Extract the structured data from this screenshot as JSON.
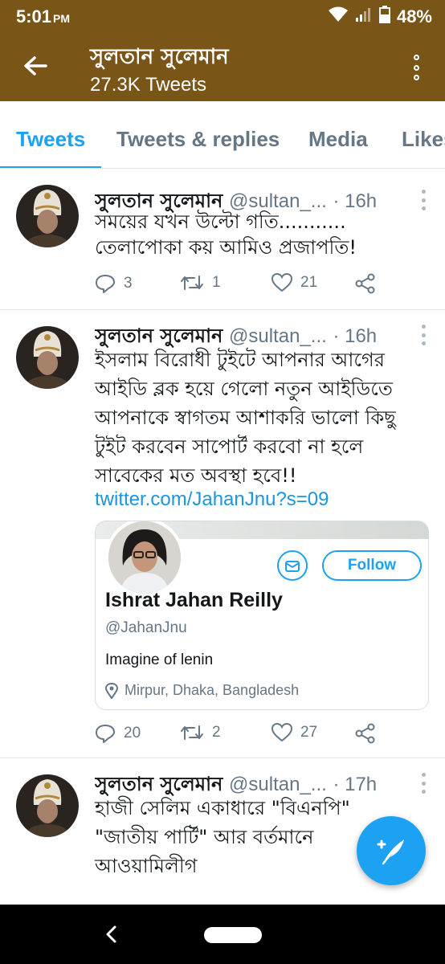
{
  "status_bar": {
    "time": "5:01",
    "ampm": "PM",
    "battery": "48%"
  },
  "header": {
    "title": "সুলতান সুলেমান",
    "subtitle": "27.3K Tweets"
  },
  "tabs": [
    {
      "label": "Tweets",
      "active": true
    },
    {
      "label": "Tweets & replies",
      "active": false
    },
    {
      "label": "Media",
      "active": false
    },
    {
      "label": "Likes",
      "active": false
    }
  ],
  "tweets": [
    {
      "name": "সুলতান সুলেমান",
      "handle": "@sultan_...",
      "time": "· 16h",
      "lines": [
        "সময়ের যখন উল্টো গতি...........",
        "তেলাপোকা কয় আমিও প্রজাপতি!"
      ],
      "replies": "3",
      "retweets": "1",
      "likes": "21"
    },
    {
      "name": "সুলতান সুলেমান",
      "handle": "@sultan_...",
      "time": "· 16h",
      "lines": [
        "ইসলাম বিরোধী টুইটে আপনার আগের",
        "আইডি ব্লক হয়ে গেলো নতুন আইডিতে",
        "আপনাকে স্বাগতম আশাকরি ভালো কিছু",
        "টুইট করবেন সাপোর্ট করবো না হলে",
        "সাবেকের মত অবস্থা হবে!!"
      ],
      "link": "twitter.com/JahanJnu?s=09",
      "card": {
        "follow_label": "Follow",
        "name": "Ishrat Jahan Reilly",
        "handle": "@JahanJnu",
        "bio": "Imagine of lenin",
        "location": "Mirpur, Dhaka, Bangladesh"
      },
      "replies": "20",
      "retweets": "2",
      "likes": "27"
    },
    {
      "name": "সুলতান সুলেমান",
      "handle": "@sultan_...",
      "time": "· 17h",
      "lines": [
        "হাজী সেলিম একাধারে \"বিএনপি\"",
        "\"জাতীয় পার্টি\" আর বর্তমানে",
        "আওয়ামিলীগ"
      ]
    }
  ],
  "colors": {
    "header_bg": "#7a5518",
    "accent": "#1da1f2",
    "muted": "#657786"
  },
  "icons": [
    "back-arrow-icon",
    "overflow-menu-icon",
    "reply-icon",
    "retweet-icon",
    "like-icon",
    "share-icon",
    "message-icon",
    "location-icon",
    "compose-icon"
  ]
}
